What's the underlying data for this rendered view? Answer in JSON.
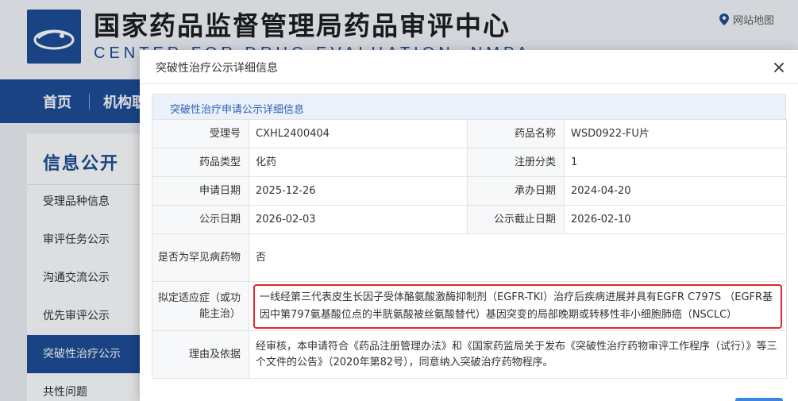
{
  "site": {
    "title": "国家药品监督管理局药品审评中心",
    "subtitle": "CENTER FOR DRUG EVALUATION, NMPA",
    "sitemap_label": "网站地图"
  },
  "nav": [
    {
      "label": "首页"
    },
    {
      "label": "机构职能"
    }
  ],
  "sidebar": {
    "heading": "信息公开",
    "items": [
      {
        "label": "受理品种信息"
      },
      {
        "label": "审评任务公示"
      },
      {
        "label": "沟通交流公示"
      },
      {
        "label": "优先审评公示"
      },
      {
        "label": "突破性治疗公示"
      },
      {
        "label": "共性问题"
      }
    ],
    "active_index": 4
  },
  "modal": {
    "title": "突破性治疗公示详细信息",
    "section_title": "突破性治疗申请公示详细信息",
    "fields": {
      "accept_no_label": "受理号",
      "accept_no": "CXHL2400404",
      "drug_name_label": "药品名称",
      "drug_name": "WSD0922-FU片",
      "drug_type_label": "药品类型",
      "drug_type": "化药",
      "reg_class_label": "注册分类",
      "reg_class": "1",
      "apply_date_label": "申请日期",
      "apply_date": "2025-12-26",
      "handle_date_label": "承办日期",
      "handle_date": "2024-04-20",
      "publish_date_label": "公示日期",
      "publish_date": "2026-02-03",
      "deadline_label": "公示截止日期",
      "deadline": "2026-02-10",
      "rare_label": "是否为罕见病药物",
      "rare": "否",
      "indication_label": "拟定适应症（或功能主治）",
      "indication": "一线经第三代表皮生长因子受体酪氨酸激酶抑制剂（EGFR-TKI）治疗后疾病进展并具有EGFR C797S （EGFR基因中第797氨基酸位点的半胱氨酸被丝氨酸替代）基因突变的局部晚期或转移性非小细胞肺癌（NSCLC）",
      "reason_label": "理由及依据",
      "reason": "经审核，本申请符合《药品注册管理办法》和《国家药监局关于发布《突破性治疗药物审评工作程序（试行）》等三个文件的公告》（2020年第82号），同意纳入突破治疗药物程序。"
    }
  },
  "colors": {
    "brand_blue": "#12438f",
    "highlight_red": "#e0282e",
    "section_bg": "#eaf1fb"
  }
}
